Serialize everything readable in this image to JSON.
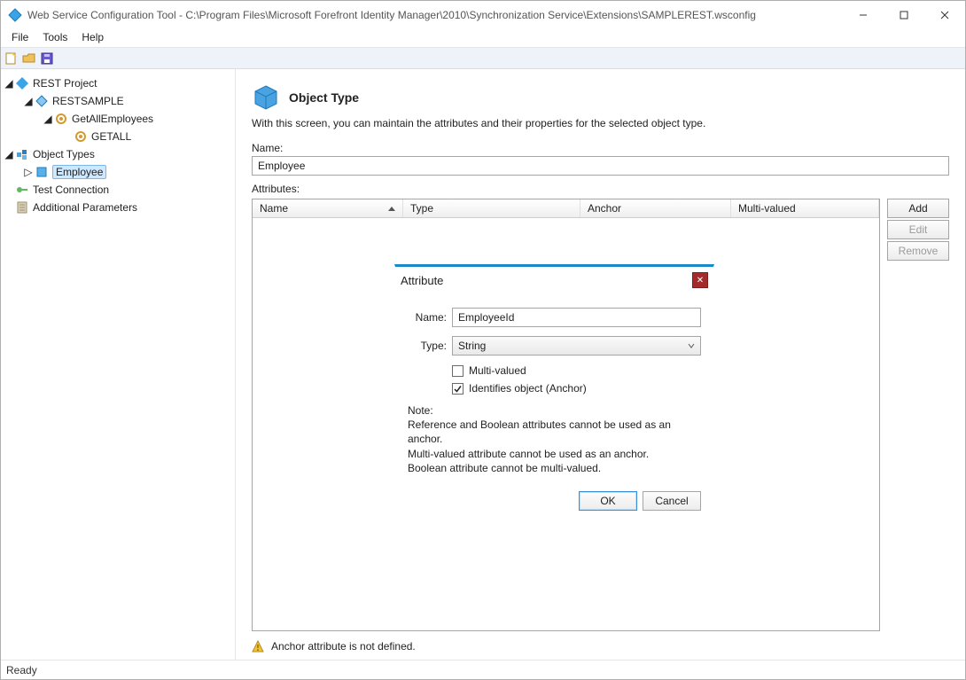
{
  "title": "Web Service Configuration Tool - C:\\Program Files\\Microsoft Forefront Identity Manager\\2010\\Synchronization Service\\Extensions\\SAMPLEREST.wsconfig",
  "menu": {
    "file": "File",
    "tools": "Tools",
    "help": "Help"
  },
  "tree": {
    "root": "REST Project",
    "ds": "RESTSAMPLE",
    "op1": "GetAllEmployees",
    "op2": "GETALL",
    "objTypes": "Object Types",
    "employee": "Employee",
    "testConn": "Test Connection",
    "addParams": "Additional Parameters"
  },
  "page": {
    "heading": "Object Type",
    "desc": "With this screen, you can maintain the attributes and their properties for the selected object type.",
    "nameLabel": "Name:",
    "nameValue": "Employee",
    "attrLabel": "Attributes:",
    "cols": {
      "name": "Name",
      "type": "Type",
      "anchor": "Anchor",
      "multi": "Multi-valued"
    },
    "buttons": {
      "add": "Add",
      "edit": "Edit",
      "remove": "Remove"
    }
  },
  "dialog": {
    "title": "Attribute",
    "nameLabel": "Name:",
    "nameValue": "EmployeeId",
    "typeLabel": "Type:",
    "typeValue": "String",
    "multiLabel": "Multi-valued",
    "anchorLabel": "Identifies object (Anchor)",
    "multiChecked": false,
    "anchorChecked": true,
    "noteLabel": "Note:",
    "note1": "Reference and Boolean attributes cannot be used as an anchor.",
    "note2": "Multi-valued attribute cannot be used as an anchor.",
    "note3": "Boolean attribute cannot be multi-valued.",
    "ok": "OK",
    "cancel": "Cancel"
  },
  "warning": "Anchor attribute is not defined.",
  "status": "Ready"
}
